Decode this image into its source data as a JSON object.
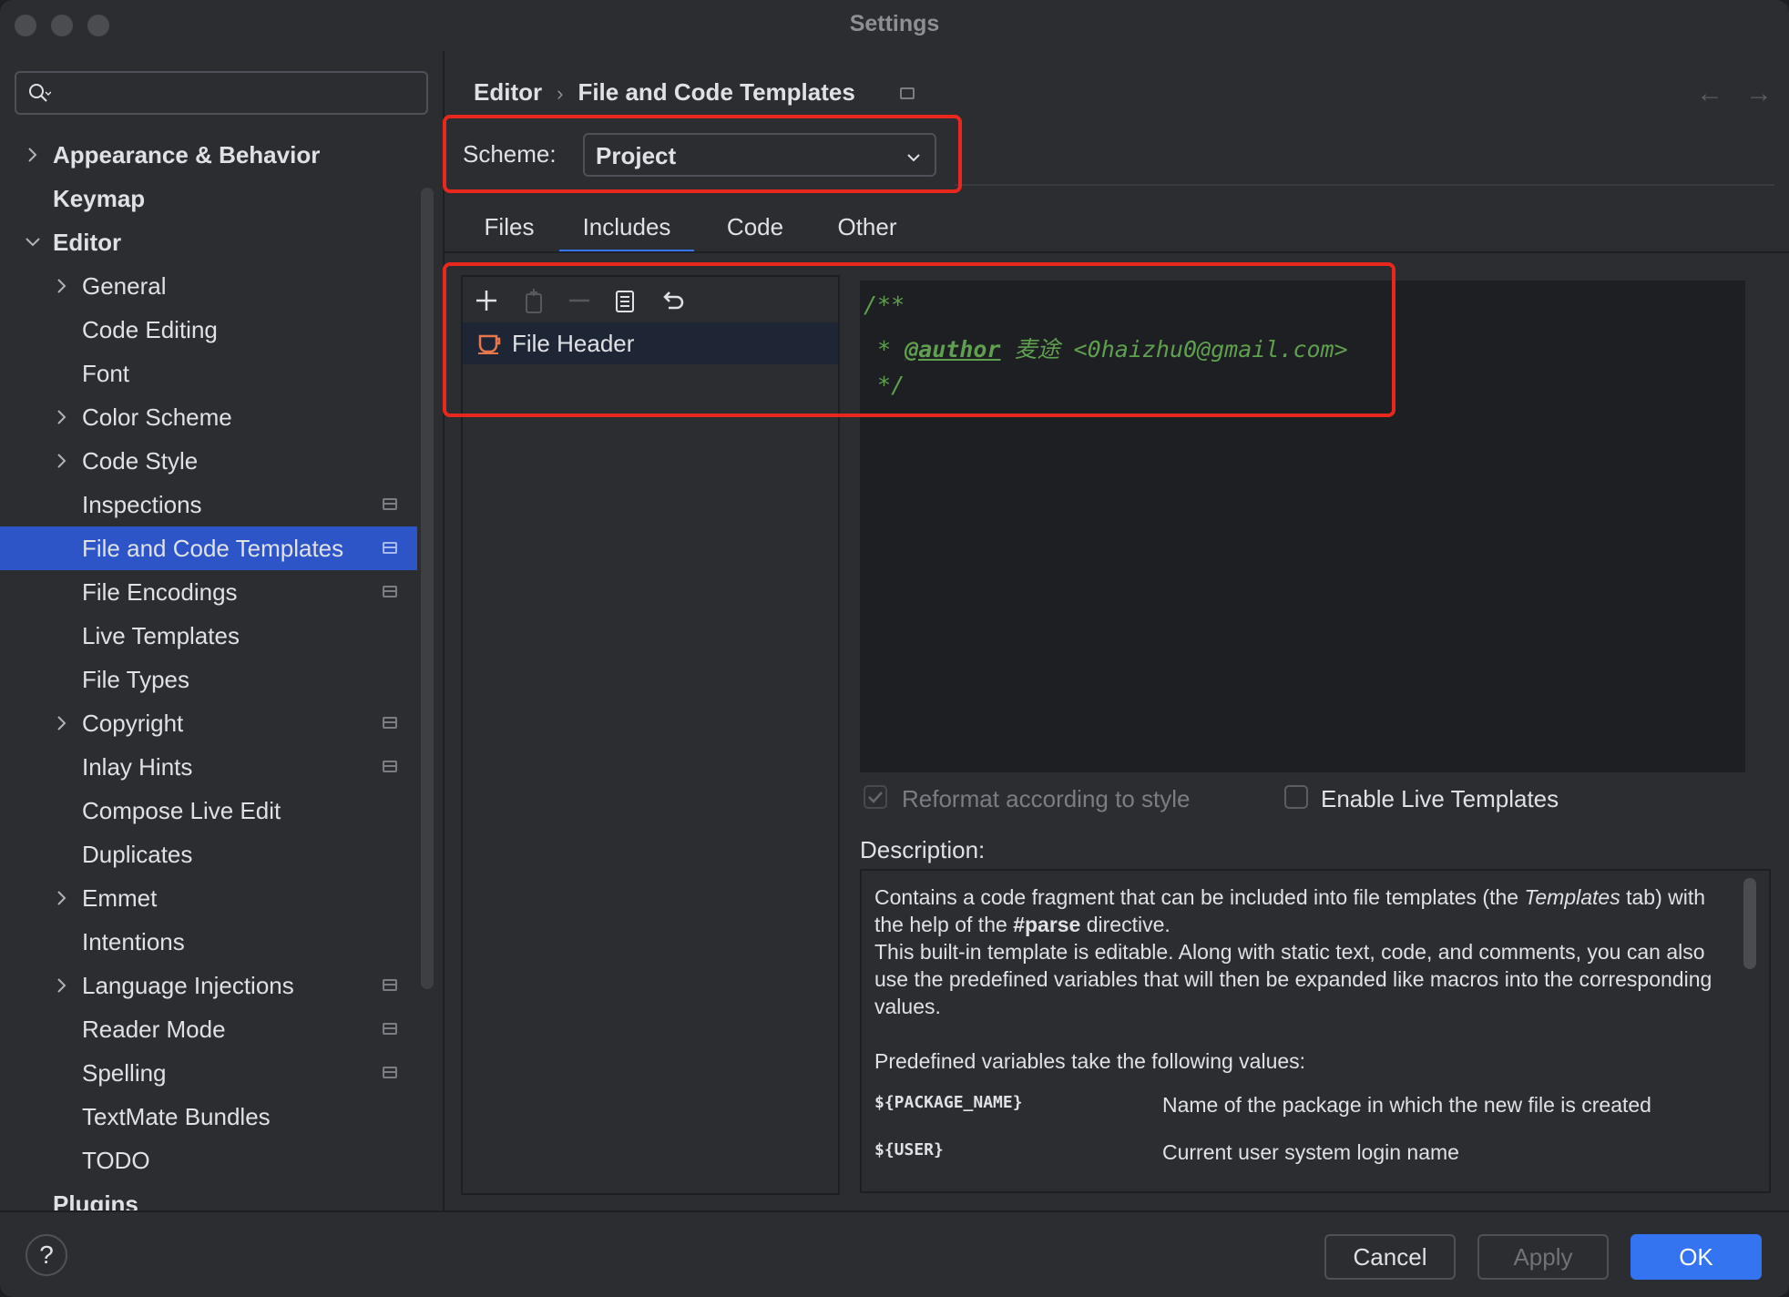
{
  "window": {
    "title": "Settings"
  },
  "sidebar": {
    "search": {
      "placeholder": ""
    },
    "items": [
      {
        "label": "Appearance & Behavior",
        "level": 0,
        "expandable": true,
        "expanded": false,
        "bold": true
      },
      {
        "label": "Keymap",
        "level": 0,
        "expandable": false,
        "bold": true
      },
      {
        "label": "Editor",
        "level": 0,
        "expandable": true,
        "expanded": true,
        "bold": true
      },
      {
        "label": "General",
        "level": 1,
        "expandable": true,
        "expanded": false
      },
      {
        "label": "Code Editing",
        "level": 1
      },
      {
        "label": "Font",
        "level": 1
      },
      {
        "label": "Color Scheme",
        "level": 1,
        "expandable": true,
        "expanded": false
      },
      {
        "label": "Code Style",
        "level": 1,
        "expandable": true,
        "expanded": false
      },
      {
        "label": "Inspections",
        "level": 1,
        "project_scope": true
      },
      {
        "label": "File and Code Templates",
        "level": 1,
        "project_scope": true,
        "selected": true
      },
      {
        "label": "File Encodings",
        "level": 1,
        "project_scope": true
      },
      {
        "label": "Live Templates",
        "level": 1
      },
      {
        "label": "File Types",
        "level": 1
      },
      {
        "label": "Copyright",
        "level": 1,
        "expandable": true,
        "expanded": false,
        "project_scope": true
      },
      {
        "label": "Inlay Hints",
        "level": 1,
        "project_scope": true
      },
      {
        "label": "Compose Live Edit",
        "level": 1
      },
      {
        "label": "Duplicates",
        "level": 1
      },
      {
        "label": "Emmet",
        "level": 1,
        "expandable": true,
        "expanded": false
      },
      {
        "label": "Intentions",
        "level": 1
      },
      {
        "label": "Language Injections",
        "level": 1,
        "expandable": true,
        "expanded": false,
        "project_scope": true
      },
      {
        "label": "Reader Mode",
        "level": 1,
        "project_scope": true
      },
      {
        "label": "Spelling",
        "level": 1,
        "project_scope": true
      },
      {
        "label": "TextMate Bundles",
        "level": 1
      },
      {
        "label": "TODO",
        "level": 1
      },
      {
        "label": "Plugins",
        "level": 0,
        "bold": true
      }
    ]
  },
  "breadcrumb": {
    "parent": "Editor",
    "separator": "›",
    "current": "File and Code Templates"
  },
  "scheme": {
    "label": "Scheme:",
    "value": "Project"
  },
  "tabs": [
    {
      "label": "Files",
      "active": false
    },
    {
      "label": "Includes",
      "active": true
    },
    {
      "label": "Code",
      "active": false
    },
    {
      "label": "Other",
      "active": false
    }
  ],
  "toolbar": {
    "icons": [
      "add-icon",
      "copy-icon",
      "remove-icon",
      "duplicate-icon",
      "reset-icon"
    ]
  },
  "templates": [
    {
      "label": "File Header",
      "icon": "java-icon",
      "selected": true
    }
  ],
  "editor": {
    "lines": [
      {
        "text": "/**"
      },
      {
        "prefix": " * ",
        "tag": "@author",
        "rest": " 麦途 <0haizhu0@gmail.com>"
      },
      {
        "text": " */"
      }
    ]
  },
  "options": {
    "reformat": {
      "label": "Reformat according to style",
      "checked": true,
      "enabled": false
    },
    "live_templates": {
      "label": "Enable Live Templates",
      "checked": false,
      "enabled": true
    }
  },
  "description": {
    "label": "Description:",
    "p1_a": "Contains a code fragment that can be included into file templates (the ",
    "p1_em": "Templates",
    "p1_b": " tab) with the help of the ",
    "p1_strong": "#parse",
    "p1_c": " directive.",
    "p2": "This built-in template is editable. Along with static text, code, and comments, you can also use the predefined variables that will then be expanded like macros into the corresponding values.",
    "p3": "Predefined variables take the following values:",
    "vars": [
      {
        "name": "${PACKAGE_NAME}",
        "desc": "Name of the package in which the new file is created"
      },
      {
        "name": "${USER}",
        "desc": "Current user system login name"
      }
    ]
  },
  "footer": {
    "help": "?",
    "cancel": "Cancel",
    "apply": "Apply",
    "ok": "OK"
  },
  "colors": {
    "accent": "#3574f0",
    "selection": "#2e55c8",
    "highlight_box": "#e8281e",
    "comment": "#5f9f4f"
  }
}
